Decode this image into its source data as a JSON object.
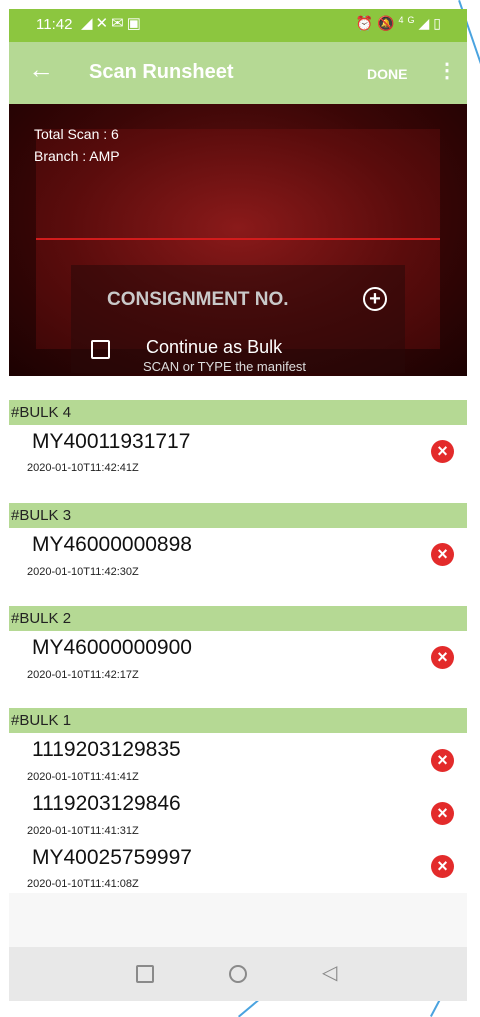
{
  "status_bar": {
    "time": "11:42",
    "left_icons": [
      "notification-icon",
      "notification-icon",
      "mail-icon",
      "gallery-icon"
    ],
    "right_icons": [
      "alarm-icon",
      "mute-icon",
      "4g-signal-icon",
      "battery-icon"
    ],
    "network": "4G"
  },
  "app_bar": {
    "title": "Scan Runsheet",
    "done_label": "DONE",
    "back_icon": "back-arrow-icon",
    "more_icon": "more-vertical-icon"
  },
  "scanner": {
    "total_scan": "Total Scan : 6",
    "branch": "Branch : AMP",
    "consignment_label": "CONSIGNMENT NO.",
    "continue_bulk_label": "Continue as Bulk",
    "continue_bulk_checked": false,
    "hint": "SCAN or TYPE the manifest"
  },
  "groups": [
    {
      "header": "#BULK 4",
      "items": [
        {
          "id": "MY40011931717",
          "timestamp": "2020-01-10T11:42:41Z"
        }
      ]
    },
    {
      "header": "#BULK 3",
      "items": [
        {
          "id": "MY46000000898",
          "timestamp": "2020-01-10T11:42:30Z"
        }
      ]
    },
    {
      "header": "#BULK 2",
      "items": [
        {
          "id": "MY46000000900",
          "timestamp": "2020-01-10T11:42:17Z"
        }
      ]
    },
    {
      "header": "#BULK 1",
      "items": [
        {
          "id": "1119203129835",
          "timestamp": "2020-01-10T11:41:41Z"
        },
        {
          "id": "1119203129846",
          "timestamp": "2020-01-10T11:41:31Z"
        },
        {
          "id": "MY40025759997",
          "timestamp": "2020-01-10T11:41:08Z"
        }
      ]
    }
  ],
  "colors": {
    "status_bar": "#8cc63f",
    "app_bar": "#b5d994",
    "group_header": "#b5d994",
    "delete_button": "#e32b2b"
  }
}
